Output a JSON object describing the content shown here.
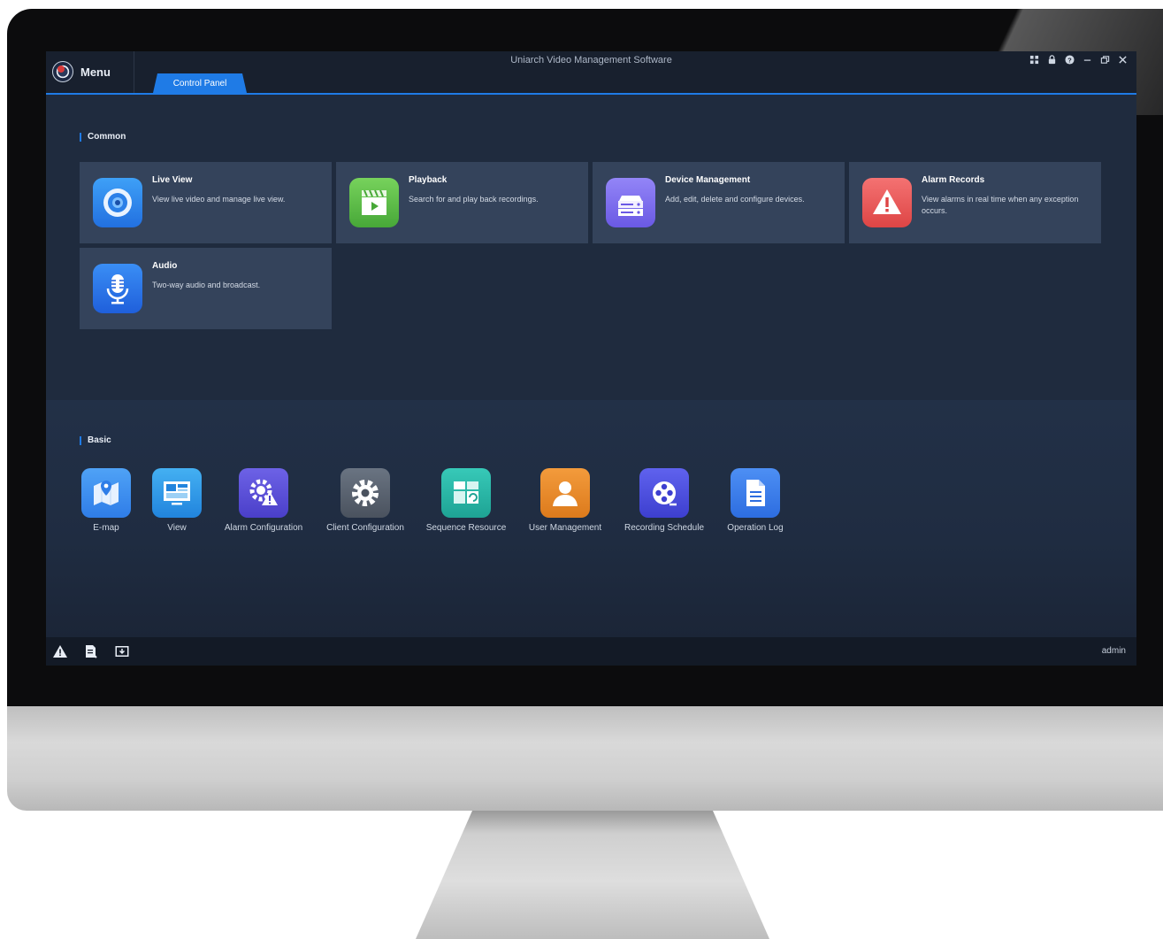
{
  "window": {
    "title": "Uniarch Video Management Software",
    "menu_label": "Menu",
    "tabs": [
      {
        "label": "Control Panel",
        "active": true
      }
    ],
    "controls": [
      "layout-icon",
      "lock-icon",
      "help-icon",
      "minimize-icon",
      "restore-icon",
      "close-icon"
    ]
  },
  "common": {
    "section_title": "Common",
    "cards": [
      {
        "title": "Live View",
        "description": "View live video and manage live view.",
        "icon": "live-view-icon",
        "color": "#2f8ef0"
      },
      {
        "title": "Playback",
        "description": "Search for and play back recordings.",
        "icon": "playback-icon",
        "color": "#5fbf4a"
      },
      {
        "title": "Device Management",
        "description": "Add, edit, delete and configure devices.",
        "icon": "device-management-icon",
        "color": "#7b6cf0"
      },
      {
        "title": "Alarm Records",
        "description": "View alarms in real time when any exception occurs.",
        "icon": "alarm-records-icon",
        "color": "#ec5a5a"
      },
      {
        "title": "Audio",
        "description": "Two-way audio and broadcast.",
        "icon": "audio-icon",
        "color": "#2f7bf0"
      }
    ]
  },
  "basic": {
    "section_title": "Basic",
    "items": [
      {
        "label": "E-map",
        "icon": "emap-icon",
        "color": "#3b8ff2"
      },
      {
        "label": "View",
        "icon": "view-icon",
        "color": "#2f9ae8"
      },
      {
        "label": "Alarm Configuration",
        "icon": "alarm-configuration-icon",
        "color": "#5b4fd6"
      },
      {
        "label": "Client Configuration",
        "icon": "client-configuration-icon",
        "color": "#565f6d"
      },
      {
        "label": "Sequence Resource",
        "icon": "sequence-resource-icon",
        "color": "#25b6a8"
      },
      {
        "label": "User Management",
        "icon": "user-management-icon",
        "color": "#ea8a2a"
      },
      {
        "label": "Recording Schedule",
        "icon": "recording-schedule-icon",
        "color": "#4f52e0"
      },
      {
        "label": "Operation Log",
        "icon": "operation-log-icon",
        "color": "#3d7ff0"
      }
    ]
  },
  "statusbar": {
    "icons": [
      "alarm-icon",
      "log-icon",
      "download-icon"
    ],
    "user": "admin"
  }
}
